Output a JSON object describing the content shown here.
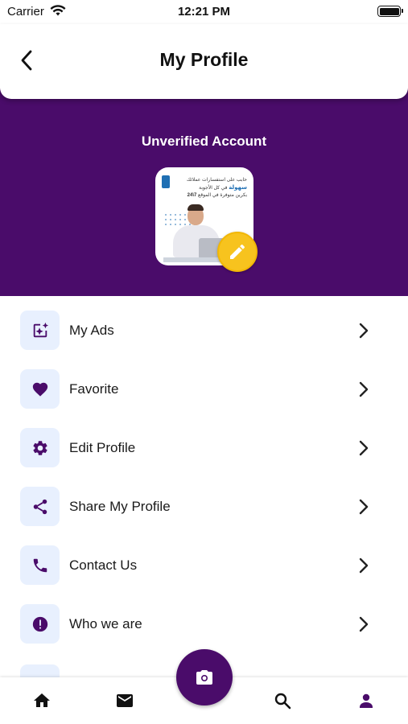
{
  "status_bar": {
    "carrier": "Carrier",
    "time": "12:21 PM"
  },
  "header": {
    "title": "My Profile"
  },
  "profile": {
    "account_status": "Unverified Account",
    "avatar_ad_text": [
      "حابب على استفسارات عملائك",
      "سهولة",
      "في كل الأجوبة",
      "بكرين متوفرة في الموقع",
      "7\\24"
    ]
  },
  "menu": {
    "items": [
      {
        "label": "My Ads",
        "icon": "ad-sparkle-icon"
      },
      {
        "label": "Favorite",
        "icon": "heart-icon"
      },
      {
        "label": "Edit Profile",
        "icon": "gear-icon"
      },
      {
        "label": "Share My Profile",
        "icon": "share-icon"
      },
      {
        "label": "Contact Us",
        "icon": "phone-icon"
      },
      {
        "label": "Who we are",
        "icon": "info-exclamation-icon"
      }
    ]
  },
  "tab_bar": {
    "items": [
      "home-icon",
      "mail-icon",
      "camera-icon",
      "search-icon",
      "profile-icon"
    ],
    "active": "profile-icon"
  },
  "colors": {
    "brand_purple": "#4a0c6a",
    "accent_yellow": "#f7c31e",
    "icon_bg": "#e8f0fe"
  }
}
